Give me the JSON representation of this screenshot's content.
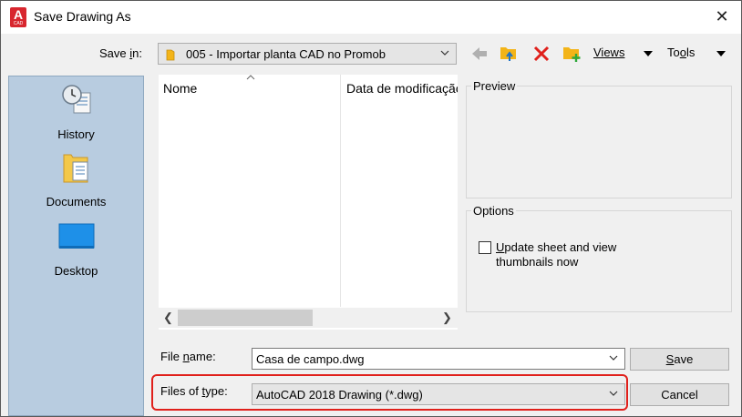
{
  "window": {
    "title": "Save Drawing As",
    "app_icon_letter": "A",
    "app_icon_sub": "CAD"
  },
  "toolbar": {
    "save_in_label_pre": "Save ",
    "save_in_label_u": "i",
    "save_in_label_post": "n:",
    "save_in_value": "005 - Importar planta CAD no Promob",
    "views_label": "Views",
    "tools_label_pre": "To",
    "tools_label_u": "o",
    "tools_label_post": "ls"
  },
  "places": {
    "items": [
      {
        "label": "History",
        "icon": "history-icon"
      },
      {
        "label": "Documents",
        "icon": "documents-folder-icon"
      },
      {
        "label": "Desktop",
        "icon": "desktop-icon"
      }
    ]
  },
  "file_list": {
    "columns": [
      "Nome",
      "Data de modificação"
    ],
    "rows": []
  },
  "preview": {
    "title": "Preview"
  },
  "options": {
    "title": "Options",
    "update_thumbnails_label_u": "U",
    "update_thumbnails_label_rest": "pdate sheet and view",
    "update_thumbnails_label_line2": "thumbnails now",
    "update_thumbnails_checked": false
  },
  "footer": {
    "file_name_label_pre": "File ",
    "file_name_label_u": "n",
    "file_name_label_post": "ame:",
    "file_name_value": "Casa de campo.dwg",
    "files_of_type_label_pre": "Files of ",
    "files_of_type_label_u": "t",
    "files_of_type_label_post": "ype:",
    "files_of_type_value": "AutoCAD 2018 Drawing (*.dwg)",
    "save_label_u": "S",
    "save_label_rest": "ave",
    "cancel_label": "Cancel"
  },
  "colors": {
    "highlight": "#e0201b",
    "places_bg": "#b8cce0",
    "delete_icon": "#e0201b",
    "folder_icon": "#f3b418"
  }
}
